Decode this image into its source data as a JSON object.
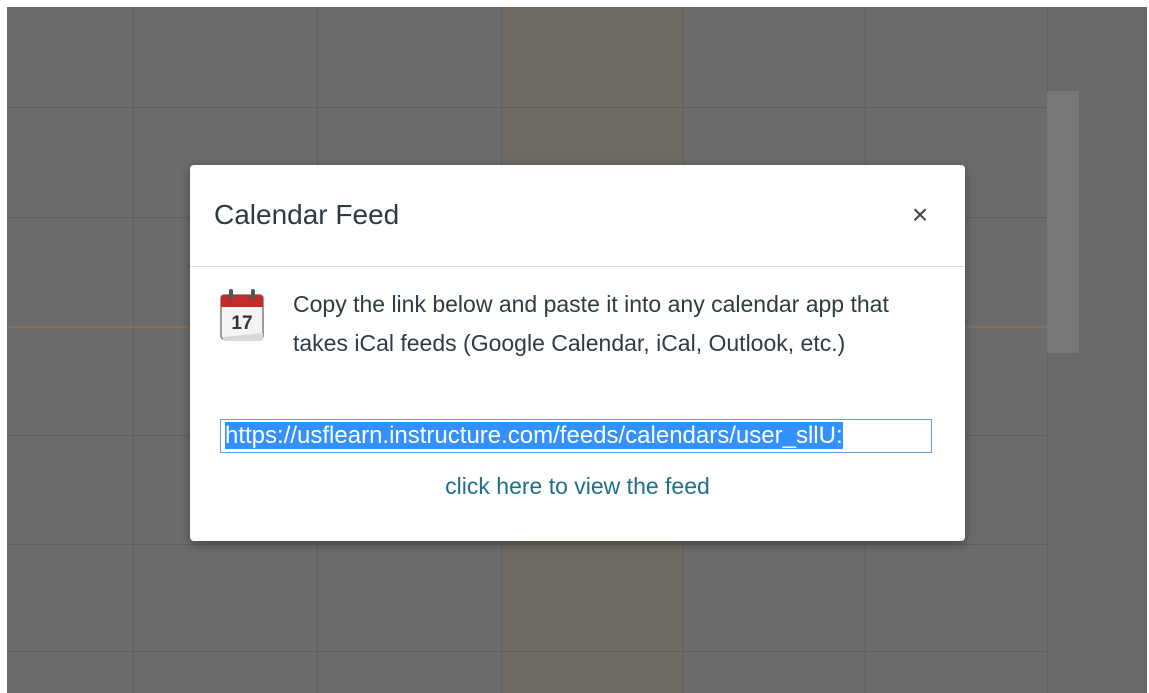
{
  "dialog": {
    "title": "Calendar Feed",
    "close_glyph": "×",
    "close_icon": "close-icon",
    "calendar_icon": "calendar-icon",
    "calendar_icon_day": "17",
    "description": "Copy the link below and paste it into any calendar app that takes iCal feeds (Google Calendar, iCal, Outlook, etc.)",
    "feed_url_value": "https://usflearn.instructure.com/feeds/calendars/user_sllU:",
    "view_feed_link": "click here to view the feed"
  },
  "colors": {
    "overlay_background": "#6b6b6b",
    "dialog_background": "#ffffff",
    "link": "#1d6f8e",
    "selection": "#3390ff",
    "calendar_icon_red": "#c62b2b"
  }
}
